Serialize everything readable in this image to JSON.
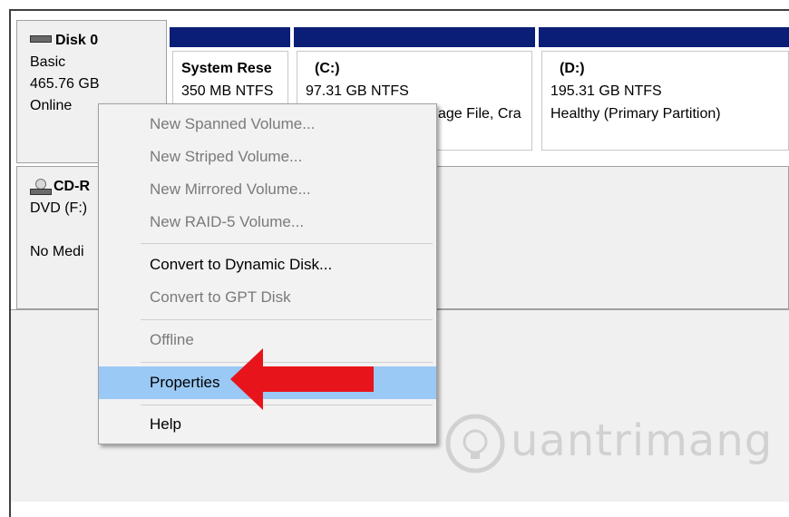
{
  "disk0": {
    "name": "Disk 0",
    "type": "Basic",
    "size": "465.76 GB",
    "status": "Online"
  },
  "partitions": [
    {
      "name": "System Rese",
      "detail": "350 MB NTFS",
      "detail2": ""
    },
    {
      "name": "(C:)",
      "detail": "97.31 GB NTFS",
      "detail2": "age File, Cra"
    },
    {
      "name": "(D:)",
      "detail": "195.31 GB NTFS",
      "detail2": "Healthy (Primary Partition)"
    }
  ],
  "cdrom": {
    "name": "CD-R",
    "type": "DVD (F:)",
    "status": "No Medi"
  },
  "context_menu": {
    "items": [
      {
        "label": "New Spanned Volume...",
        "enabled": false
      },
      {
        "label": "New Striped Volume...",
        "enabled": false
      },
      {
        "label": "New Mirrored Volume...",
        "enabled": false
      },
      {
        "label": "New RAID-5 Volume...",
        "enabled": false
      },
      {
        "label": "Convert to Dynamic Disk...",
        "enabled": true
      },
      {
        "label": "Convert to GPT Disk",
        "enabled": false
      },
      {
        "label": "Offline",
        "enabled": false
      },
      {
        "label": "Properties",
        "enabled": true,
        "highlighted": true
      },
      {
        "label": "Help",
        "enabled": true
      }
    ]
  },
  "annotation": {
    "arrow_color": "#e8141b",
    "points_to": "Properties"
  },
  "watermark": {
    "text": "uantrimang"
  },
  "colors": {
    "partition_bar": "#0a1e78",
    "highlight": "#99c9f4",
    "disabled_text": "#7a7a7a"
  }
}
